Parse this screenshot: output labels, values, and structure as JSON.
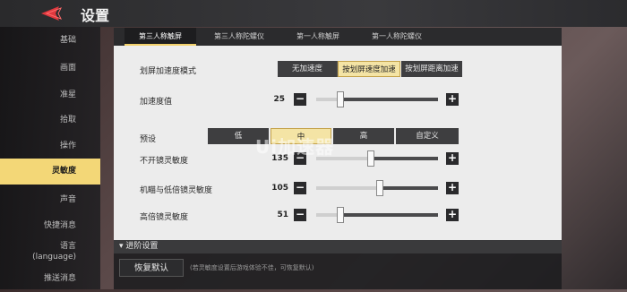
{
  "header": {
    "title": "设置"
  },
  "sidebar": {
    "items": [
      {
        "label": "基础"
      },
      {
        "label": "画面"
      },
      {
        "label": "准星"
      },
      {
        "label": "拾取"
      },
      {
        "label": "操作"
      },
      {
        "label": "灵敏度"
      },
      {
        "label": "声音"
      },
      {
        "label": "快捷消息"
      },
      {
        "label": "语言",
        "label2": "(language)"
      },
      {
        "label": "推送消息"
      }
    ],
    "active_index": 5
  },
  "tabs": [
    {
      "label": "第三人称触屏"
    },
    {
      "label": "第三人称陀螺仪"
    },
    {
      "label": "第一人称触屏"
    },
    {
      "label": "第一人称陀螺仪"
    }
  ],
  "scroll_accel": {
    "label": "划屏加速度模式",
    "options": [
      "无加速度",
      "按划屏速度加速",
      "按划屏距离加速"
    ],
    "selected": 1
  },
  "accel_value": {
    "label": "加速度值",
    "value": "25",
    "level": 0.2
  },
  "preset": {
    "label": "预设",
    "options": [
      "低",
      "中",
      "高",
      "自定义"
    ],
    "selected": 1
  },
  "sliders": [
    {
      "label": "不开镜灵敏度",
      "value": "135",
      "level": 0.45
    },
    {
      "label": "机瞄与低倍镜灵敏度",
      "value": "105",
      "level": 0.52
    },
    {
      "label": "高倍镜灵敏度",
      "value": "51",
      "level": 0.2
    }
  ],
  "advanced": {
    "label": "▾ 进阶设置"
  },
  "footer": {
    "restore_label": "恢复默认",
    "hint": "(若灵敏度设置后游戏体验不佳，可恢复默认)"
  },
  "watermark": "Ui加速器"
}
